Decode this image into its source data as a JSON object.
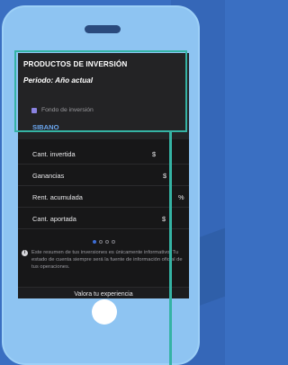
{
  "header": {
    "title": "PRODUCTOS DE INVERSIÓN",
    "period": "Periodo: Año actual"
  },
  "fund": {
    "label": "Fondo de inversión",
    "icon": "chart-icon",
    "name": "SIBANO"
  },
  "metrics": [
    {
      "label": "Cant. invertida",
      "unit": "$"
    },
    {
      "label": "Ganancias",
      "unit": "$"
    },
    {
      "label": "Rent. acumulada",
      "unit": "%"
    },
    {
      "label": "Cant. aportada",
      "unit": "$"
    }
  ],
  "pagination": {
    "total": 4,
    "current": 1
  },
  "disclaimer": {
    "text": "Este resumen de tus inversiones es únicamente informativo. Tu estado de cuenta siempre será la fuente de información oficial de tus operaciones."
  },
  "feedback": {
    "label": "Valora tu experiencia"
  },
  "colors": {
    "highlight": "#35b3a4",
    "accent_link": "#6ba6ef",
    "device": "#8ec4f2",
    "background": "#3a6fc2"
  }
}
